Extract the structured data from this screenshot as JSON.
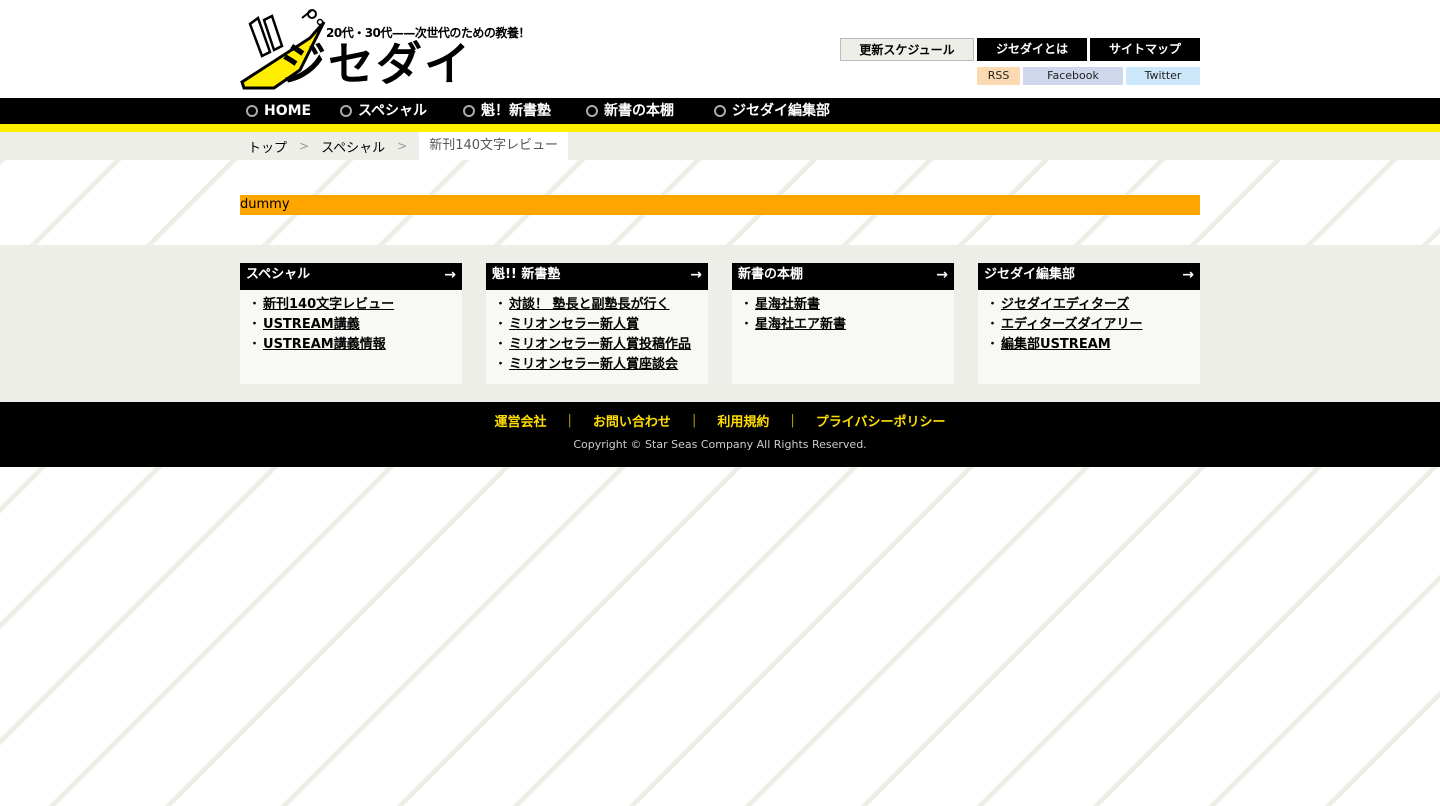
{
  "logo": {
    "tagline": "20代・30代——次世代のための教養！",
    "name": "ジセダイ"
  },
  "utility": {
    "schedule": "更新スケジュール",
    "about": "ジセダイとは",
    "sitemap": "サイトマップ"
  },
  "feeds": {
    "rss": "RSS",
    "facebook": "Facebook",
    "twitter": "Twitter"
  },
  "gnav": [
    {
      "label": "HOME"
    },
    {
      "label": "スペシャル"
    },
    {
      "label": "魁！新書塾"
    },
    {
      "label": "新書の本棚"
    },
    {
      "label": "ジセダイ編集部"
    }
  ],
  "breadcrumb": {
    "top": "トップ",
    "special": "スペシャル",
    "current": "新刊140文字レビュー"
  },
  "content": {
    "dummy": "dummy"
  },
  "sections": [
    {
      "title": "スペシャル",
      "items": [
        "新刊140文字レビュー",
        "USTREAM講義",
        "USTREAM講義情報"
      ]
    },
    {
      "title": "魁!! 新書塾",
      "items": [
        "対談！ 塾長と副塾長が行く",
        "ミリオンセラー新人賞",
        "ミリオンセラー新人賞投稿作品",
        "ミリオンセラー新人賞座談会"
      ]
    },
    {
      "title": "新書の本棚",
      "items": [
        "星海社新書",
        "星海社エア新書"
      ]
    },
    {
      "title": "ジセダイ編集部",
      "items": [
        "ジセダイエディターズ",
        "エディターズダイアリー",
        "編集部USTREAM"
      ]
    }
  ],
  "footer": {
    "links": [
      "運営会社",
      "お問い合わせ",
      "利用規約",
      "プライバシーポリシー"
    ],
    "separator": "|",
    "copyright": "Copyright © Star Seas Company All Rights Reserved."
  },
  "colors": {
    "accent_yellow": "#ffee00",
    "dummy_orange": "#ffa500"
  }
}
